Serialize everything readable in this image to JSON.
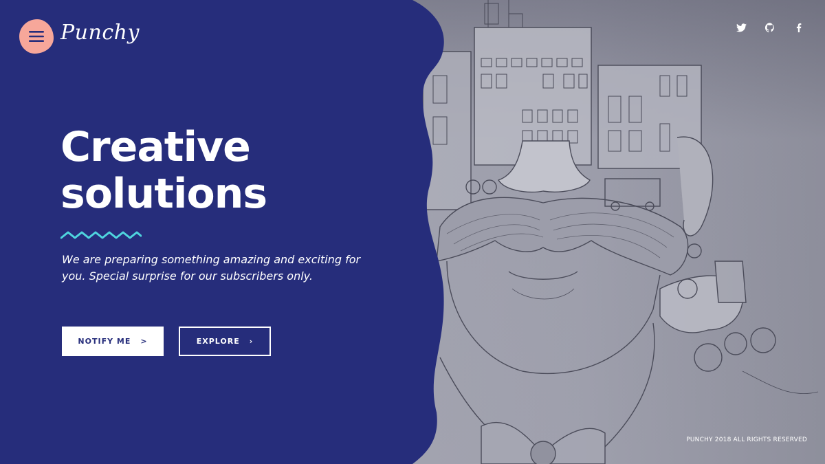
{
  "brand": {
    "name": "Punchy",
    "menu_icon": "hamburger-icon"
  },
  "colors": {
    "panel": "#262d7b",
    "accent_blob": "#f7a79a",
    "wave": "#4fd5de",
    "text": "#ffffff"
  },
  "social": [
    {
      "name": "twitter-icon"
    },
    {
      "name": "github-icon"
    },
    {
      "name": "facebook-icon"
    }
  ],
  "hero": {
    "title_line1": "Creative",
    "title_line2": "solutions",
    "description": "We are preparing something amazing and exciting for you. Special surprise for our subscribers only."
  },
  "buttons": {
    "notify_label": "NOTIFY ME",
    "notify_icon": ">",
    "explore_label": "EXPLORE",
    "explore_icon": "›"
  },
  "footer": {
    "copyright": "PUNCHY 2018 ALL RIGHTS RESERVED"
  }
}
